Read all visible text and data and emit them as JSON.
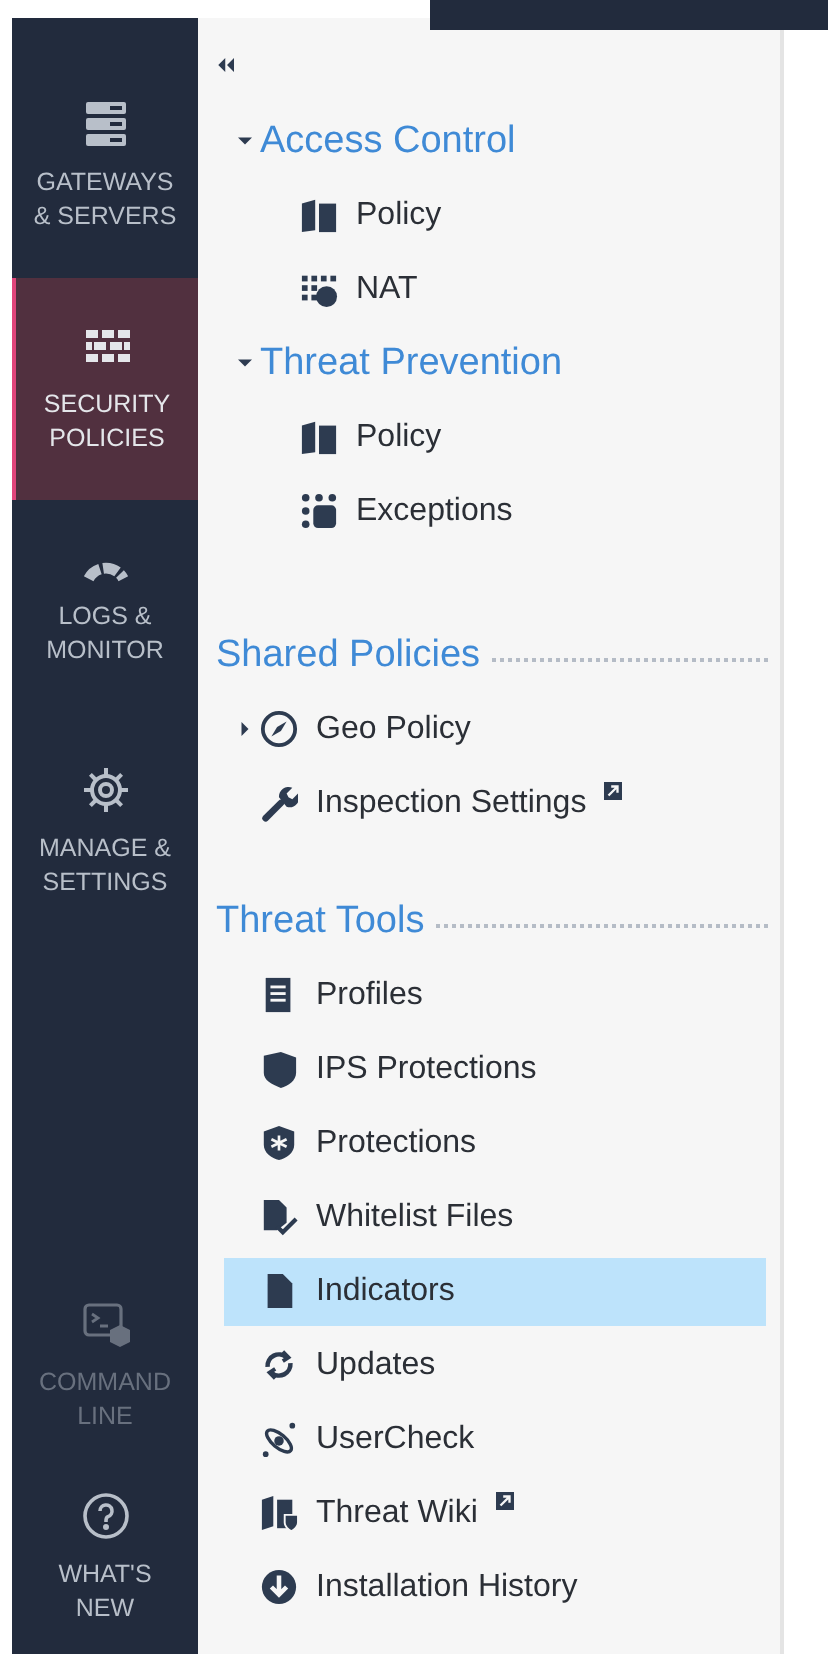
{
  "sidebar": {
    "items": [
      {
        "label": "GATEWAYS & SERVERS",
        "selected": false,
        "disabled": false
      },
      {
        "label": "SECURITY POLICIES",
        "selected": true,
        "disabled": false
      },
      {
        "label": "LOGS & MONITOR",
        "selected": false,
        "disabled": false
      },
      {
        "label": "MANAGE & SETTINGS",
        "selected": false,
        "disabled": false
      },
      {
        "label": "COMMAND LINE",
        "selected": false,
        "disabled": true
      },
      {
        "label": "WHAT'S NEW",
        "selected": false,
        "disabled": false
      }
    ]
  },
  "panel": {
    "groups": [
      {
        "title": "Access Control",
        "kind": "tree",
        "expanded": true,
        "items": [
          {
            "label": "Policy",
            "selected": false,
            "external": false
          },
          {
            "label": "NAT",
            "selected": false,
            "external": false
          }
        ]
      },
      {
        "title": "Threat Prevention",
        "kind": "tree",
        "expanded": true,
        "items": [
          {
            "label": "Policy",
            "selected": false,
            "external": false
          },
          {
            "label": "Exceptions",
            "selected": false,
            "external": false
          }
        ]
      },
      {
        "title": "Shared Policies",
        "kind": "section",
        "items": [
          {
            "label": "Geo Policy",
            "selected": false,
            "external": false,
            "expanded": false
          },
          {
            "label": "Inspection Settings",
            "selected": false,
            "external": true
          }
        ]
      },
      {
        "title": "Threat Tools",
        "kind": "section",
        "items": [
          {
            "label": "Profiles",
            "selected": false,
            "external": false
          },
          {
            "label": "IPS Protections",
            "selected": false,
            "external": false
          },
          {
            "label": "Protections",
            "selected": false,
            "external": false
          },
          {
            "label": "Whitelist Files",
            "selected": false,
            "external": false
          },
          {
            "label": "Indicators",
            "selected": true,
            "external": false
          },
          {
            "label": "Updates",
            "selected": false,
            "external": false
          },
          {
            "label": "UserCheck",
            "selected": false,
            "external": false
          },
          {
            "label": "Threat Wiki",
            "selected": false,
            "external": true
          },
          {
            "label": "Installation History",
            "selected": false,
            "external": false
          }
        ]
      }
    ]
  }
}
